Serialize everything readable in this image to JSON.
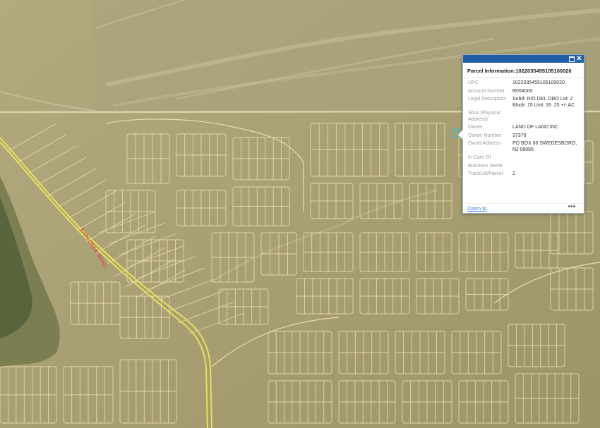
{
  "map": {
    "road_label": "EXPLORER ROAD",
    "basemap": "satellite imagery with parcel boundary overlay",
    "parcel_line_color": "#e9dfad",
    "road_line_color": "#e6e15a",
    "selection_color": "#27c3e6"
  },
  "popup": {
    "title": "Parcel Information:1022035455105100020",
    "header_color": "#1f5da8",
    "maximize_icon": "maximize-icon",
    "close_icon": "close-icon",
    "fields": [
      {
        "label": "UPC",
        "value": "1022035455105100020"
      },
      {
        "label": "Account Number",
        "value": "R054000"
      },
      {
        "label": "Legal Description",
        "value": "Subd: RIO DEL ORO Lot: 2 Block: 15 Unit: 26 .25 +/- AC"
      },
      {
        "label": "Situs (Physical Address)",
        "value": ""
      },
      {
        "label": "Owner",
        "value": "LAND OF LAND INC"
      },
      {
        "label": "Owner Number",
        "value": "37378"
      },
      {
        "label": "OwnerAddress",
        "value": "PO BOX 66 SWEDESBORO, NJ 08085"
      },
      {
        "label": "In Care Of",
        "value": ""
      },
      {
        "label": "Business Name",
        "value": ""
      },
      {
        "label": "Tract/Lot/Parcel",
        "value": "2"
      }
    ],
    "zoom_label": "Zoom to",
    "more_label": "•••"
  }
}
